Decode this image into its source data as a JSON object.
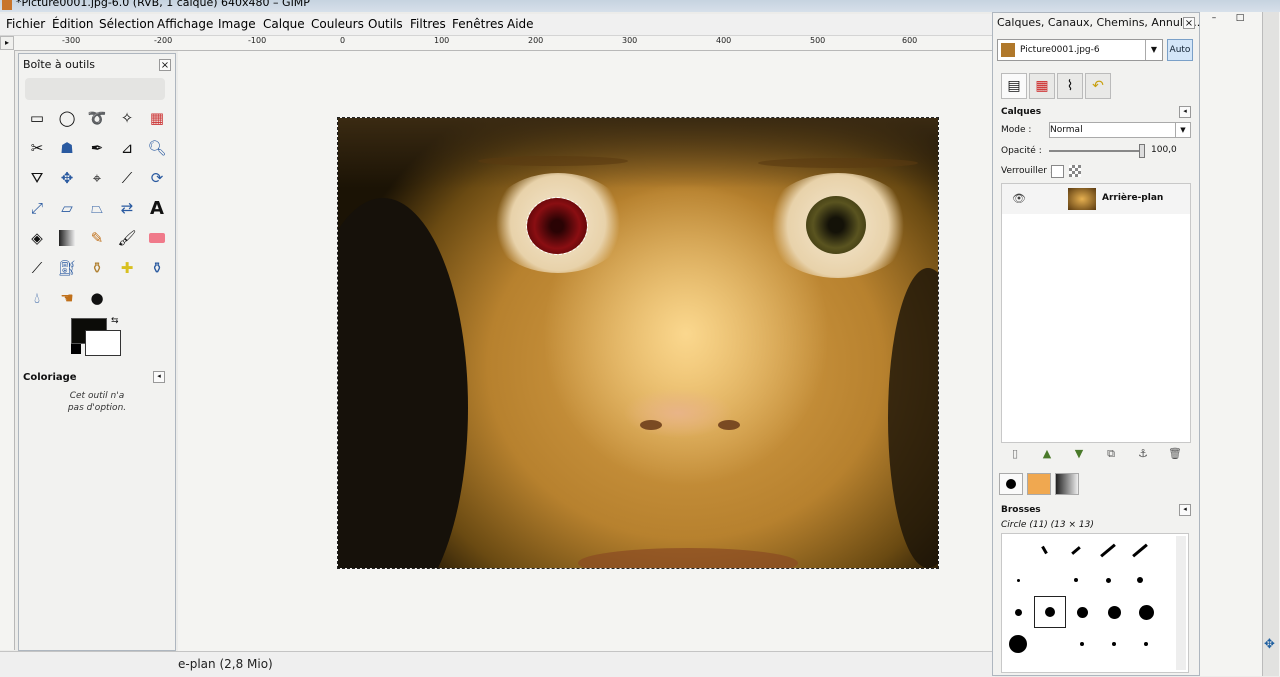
{
  "window": {
    "title": "*Picture0001.jpg-6.0 (RVB, 1 calque) 640x480 – GIMP",
    "minimize": "–",
    "maximize": "□",
    "close": "✕"
  },
  "menu": [
    "Fichier",
    "Édition",
    "Sélection",
    "Affichage",
    "Image",
    "Calque",
    "Couleurs",
    "Outils",
    "Filtres",
    "Fenêtres",
    "Aide"
  ],
  "ruler": {
    "labels": [
      "-300",
      "-200",
      "-100",
      "0",
      "100",
      "200",
      "300",
      "400",
      "500",
      "600"
    ]
  },
  "toolbox": {
    "title": "Boîte à outils",
    "close": "×",
    "tool_options_title": "Coloriage",
    "tool_options_text_1": "Cet outil n'a",
    "tool_options_text_2": "pas d'option.",
    "fg_color": "#0c0c08",
    "bg_color": "#ffffff"
  },
  "statusbar": {
    "text": "e-plan (2,8 Mio)"
  },
  "dock": {
    "title": "Calques, Canaux, Chemins, Annuler...",
    "close": "×",
    "image_select": "Picture0001.jpg-6",
    "auto_button": "Auto",
    "layers_title": "Calques",
    "mode_label": "Mode :",
    "mode_value": "Normal",
    "opacity_label": "Opacité :",
    "opacity_value": "100,0",
    "opacity_fraction": 1.0,
    "lock_label": "Verrouiller :",
    "layer_name": "Arrière-plan",
    "brushes_title": "Brosses",
    "brush_name": "Circle (11) (13 × 13)"
  }
}
